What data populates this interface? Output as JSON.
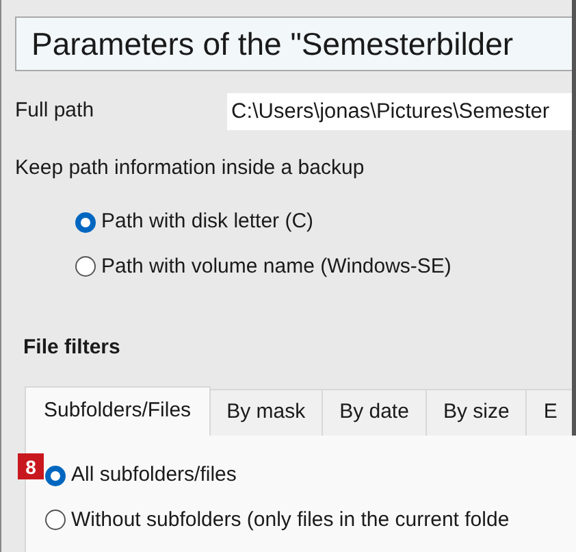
{
  "title": "Parameters of the \"Semesterbilder",
  "full_path": {
    "label": "Full path",
    "value": "C:\\Users\\jonas\\Pictures\\Semester"
  },
  "keep_path": {
    "label": "Keep path information inside a backup",
    "options": [
      {
        "label": "Path with disk letter (C)",
        "selected": true
      },
      {
        "label": "Path with volume name (Windows-SE)",
        "selected": false
      }
    ]
  },
  "file_filters": {
    "heading": "File filters",
    "tabs": [
      {
        "label": "Subfolders/Files",
        "selected": true
      },
      {
        "label": "By mask",
        "selected": false
      },
      {
        "label": "By date",
        "selected": false
      },
      {
        "label": "By size",
        "selected": false
      },
      {
        "label": "E",
        "selected": false
      }
    ],
    "options": [
      {
        "label": "All subfolders/files",
        "selected": true,
        "badge": "8"
      },
      {
        "label": "Without subfolders (only files in the current folde",
        "selected": false
      }
    ]
  }
}
